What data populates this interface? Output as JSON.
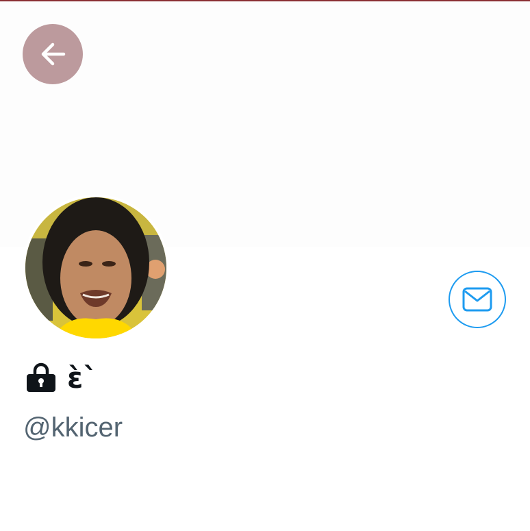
{
  "profile": {
    "display_name": "ɛ̀`",
    "handle": "@kkicer",
    "is_protected": true
  },
  "icons": {
    "back": "arrow-left-icon",
    "message": "envelope-icon",
    "protected": "lock-icon"
  },
  "colors": {
    "top_line": "#8a2f33",
    "back_button_bg": "#bc9a9d",
    "accent": "#1d9bf0",
    "name_text": "#0f1419",
    "handle_text": "#536471"
  }
}
